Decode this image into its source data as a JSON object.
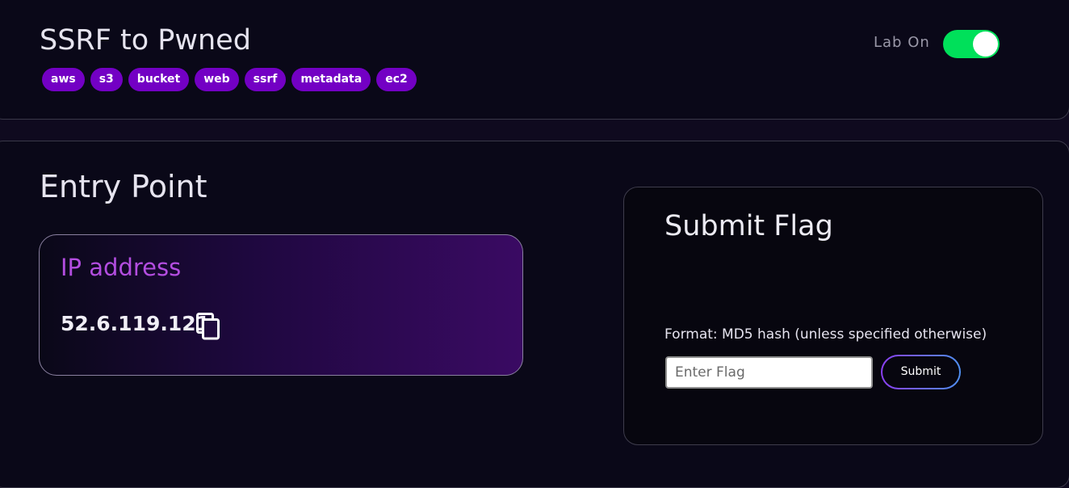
{
  "header": {
    "title": "SSRF to Pwned",
    "tags": [
      "aws",
      "s3",
      "bucket",
      "web",
      "ssrf",
      "metadata",
      "ec2"
    ],
    "lab_label": "Lab On",
    "lab_on": true,
    "toggle_color": "#00e05a",
    "tag_color": "#7300c4"
  },
  "entry_point": {
    "title": "Entry Point",
    "ip_label": "IP address",
    "ip_value": "52.6.119.121",
    "copy_icon": "copy-icon"
  },
  "submit_flag": {
    "title": "Submit Flag",
    "format_text": "Format: MD5 hash (unless specified otherwise)",
    "input_placeholder": "Enter Flag",
    "input_value": "",
    "submit_label": "Submit"
  }
}
